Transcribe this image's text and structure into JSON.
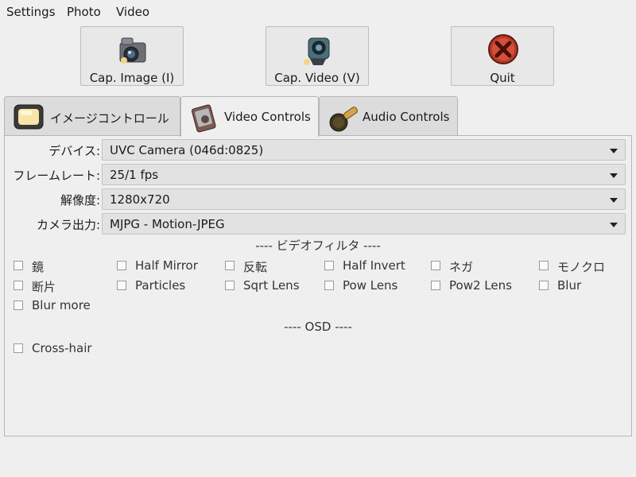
{
  "menu": {
    "items": [
      "Settings",
      "Photo",
      "Video"
    ]
  },
  "toolbar": {
    "cap_image": {
      "label": "Cap. Image (I)",
      "icon": "camera-icon"
    },
    "cap_video": {
      "label": "Cap. Video (V)",
      "icon": "video-camera-icon"
    },
    "quit": {
      "label": "Quit",
      "icon": "quit-icon"
    }
  },
  "tabs": [
    {
      "label": "イメージコントロール",
      "icon": "tv-icon",
      "active": false
    },
    {
      "label": "Video Controls",
      "icon": "video-controls-icon",
      "active": true
    },
    {
      "label": "Audio Controls",
      "icon": "microphone-icon",
      "active": false
    }
  ],
  "settings": {
    "device": {
      "label": "デバイス:",
      "value": "UVC Camera (046d:0825)"
    },
    "framerate": {
      "label": "フレームレート:",
      "value": "25/1 fps"
    },
    "resolution": {
      "label": "解像度:",
      "value": "1280x720"
    },
    "camera_output": {
      "label": "カメラ出力:",
      "value": "MJPG - Motion-JPEG"
    }
  },
  "video_filters": {
    "title": "---- ビデオフィルタ ----",
    "items": [
      "鏡",
      "Half Mirror",
      "反転",
      "Half Invert",
      "ネガ",
      "モノクロ",
      "断片",
      "Particles",
      "Sqrt Lens",
      "Pow Lens",
      "Pow2 Lens",
      "Blur",
      "Blur more"
    ]
  },
  "osd": {
    "title": "---- OSD ----",
    "items": [
      "Cross-hair"
    ]
  }
}
